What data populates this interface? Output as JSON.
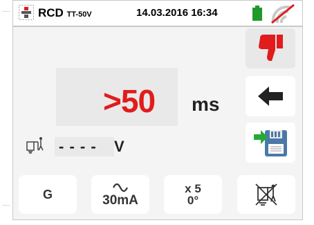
{
  "status": {
    "mode": "RCD",
    "mode_sub": "TT-50V",
    "datetime": "14.03.2016  16:34",
    "battery_icon": "battery-icon",
    "signal_icon": "wireless-disabled-icon"
  },
  "result": {
    "value": ">50",
    "unit": "ms",
    "color": "#e11c1c"
  },
  "contact_voltage": {
    "value": "- - - -",
    "unit": "V",
    "icon": "contact-voltage-icon"
  },
  "side_buttons": {
    "verdict_icon": "thumbs-down-icon",
    "back_icon": "back-arrow-icon",
    "save_icon": "save-icon"
  },
  "params": {
    "type": "G",
    "waveform_icon": "ac-sine-icon",
    "current": "30mA",
    "multiplier": "x 5",
    "angle": "0°",
    "ground_icon": "ground-probe-disabled-icon"
  }
}
